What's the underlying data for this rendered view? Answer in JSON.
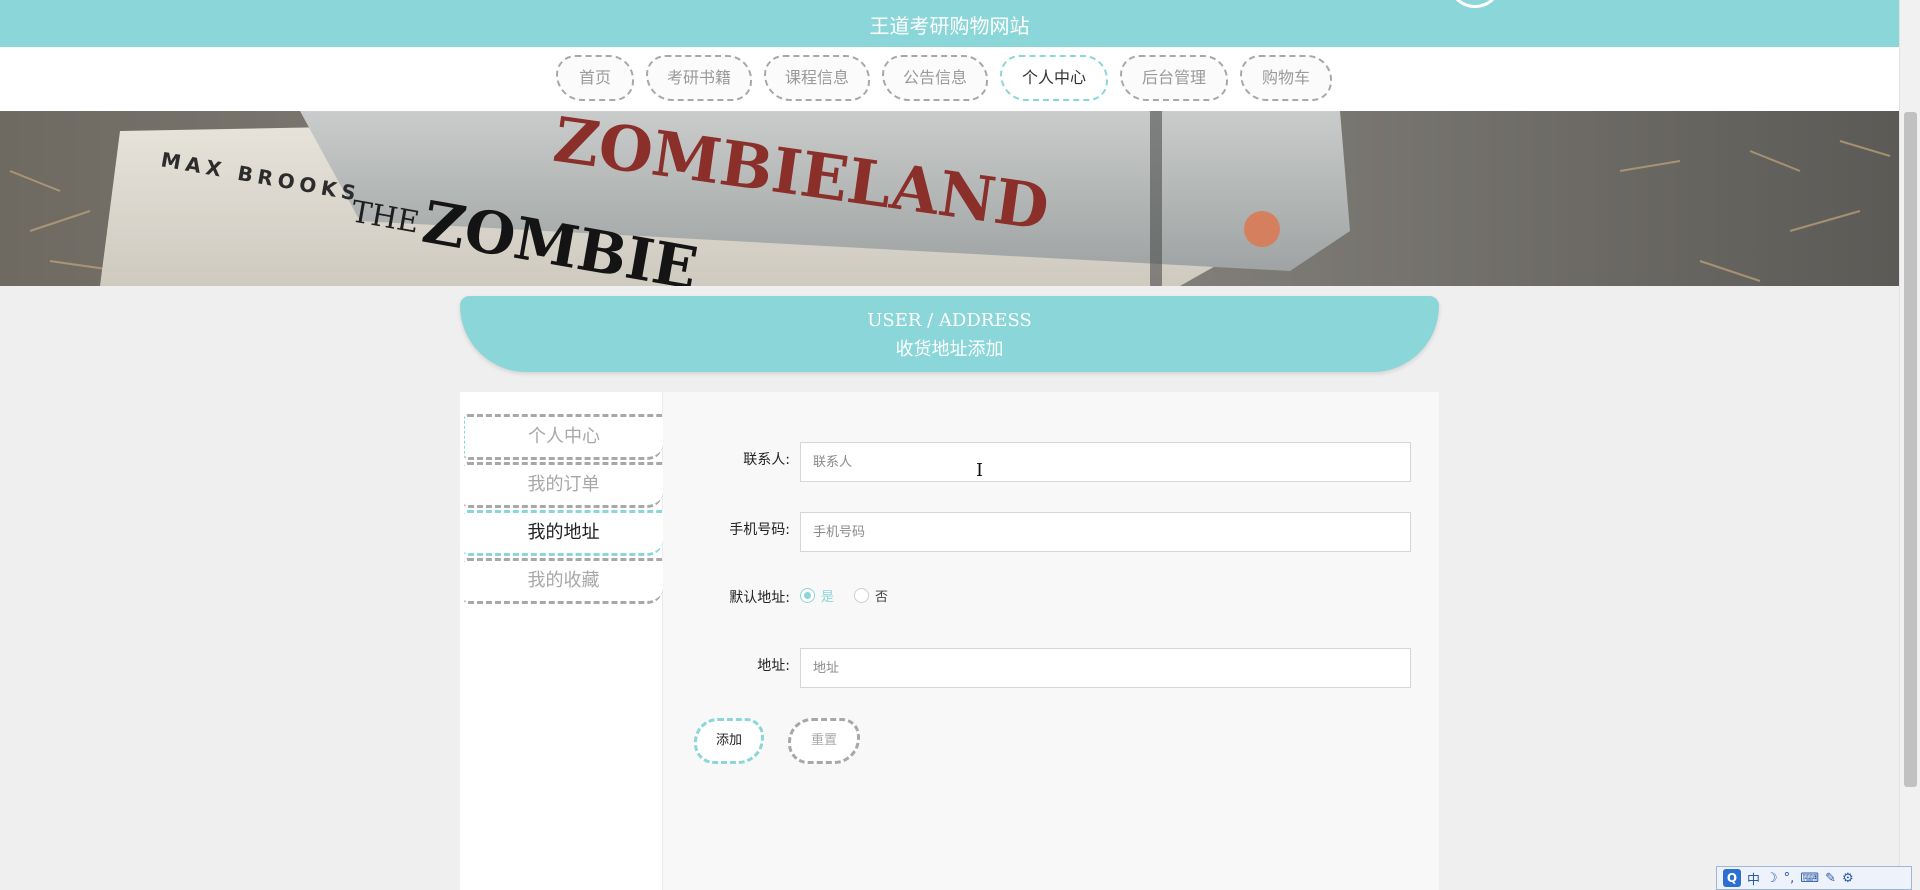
{
  "header": {
    "site_title": "王道考研购物网站"
  },
  "nav": {
    "items": [
      {
        "label": "首页",
        "active": false
      },
      {
        "label": "考研书籍",
        "active": false
      },
      {
        "label": "课程信息",
        "active": false
      },
      {
        "label": "公告信息",
        "active": false
      },
      {
        "label": "个人中心",
        "active": true
      },
      {
        "label": "后台管理",
        "active": false
      },
      {
        "label": "购物车",
        "active": false
      }
    ]
  },
  "banner": {
    "texts": [
      "ZOMBIELAND",
      "MAX BROOKS",
      "THE",
      "ZOMBIE"
    ]
  },
  "section": {
    "title_en": "USER / ADDRESS",
    "title_cn": "收货地址添加"
  },
  "sidebar": {
    "items": [
      {
        "label": "个人中心",
        "active": false
      },
      {
        "label": "我的订单",
        "active": false
      },
      {
        "label": "我的地址",
        "active": true
      },
      {
        "label": "我的收藏",
        "active": false
      }
    ]
  },
  "form": {
    "contact": {
      "label": "联系人:",
      "placeholder": "联系人",
      "value": ""
    },
    "phone": {
      "label": "手机号码:",
      "placeholder": "手机号码",
      "value": ""
    },
    "default": {
      "label": "默认地址:",
      "option_yes": "是",
      "option_no": "否",
      "selected": "是"
    },
    "address": {
      "label": "地址:",
      "placeholder": "地址",
      "value": ""
    },
    "add_button": "添加",
    "reset_button": "重置"
  },
  "ime_toolbar": {
    "logo": "Q",
    "items": [
      "中",
      "☽",
      "°,",
      "⌨",
      "✎",
      "⚙"
    ]
  },
  "colors": {
    "accent": "#8bd6d8",
    "background": "#efefef",
    "dashed_border": "#a8a8a8"
  }
}
